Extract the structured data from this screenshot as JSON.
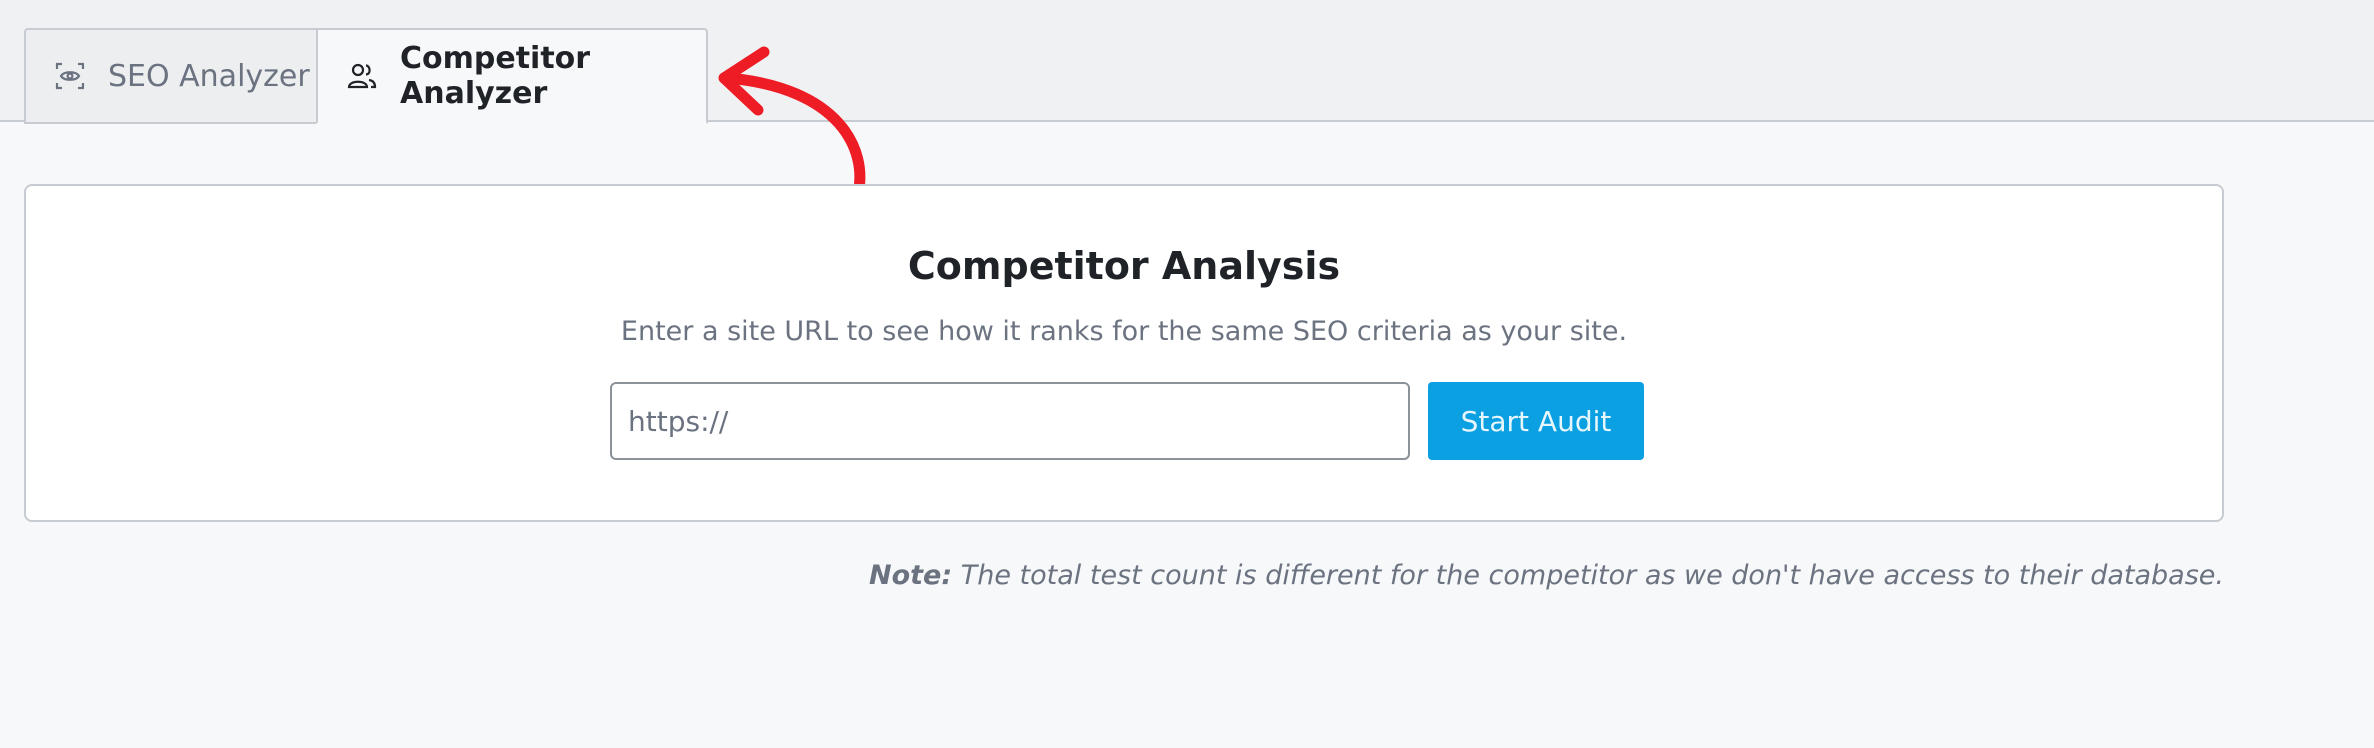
{
  "tabs": [
    {
      "label": "SEO Analyzer",
      "icon": "eye-scan-icon",
      "active": false
    },
    {
      "label": "Competitor Analyzer",
      "icon": "users-icon",
      "active": true
    }
  ],
  "card": {
    "title": "Competitor Analysis",
    "description": "Enter a site URL to see how it ranks for the same SEO criteria as your site.",
    "url_placeholder": "https://",
    "button_label": "Start Audit"
  },
  "note": {
    "label": "Note:",
    "text": "The total test count is different for the competitor as we don't have access to their database."
  },
  "colors": {
    "accent": "#0ba0e2",
    "annotation_arrow": "#ee1c24"
  }
}
